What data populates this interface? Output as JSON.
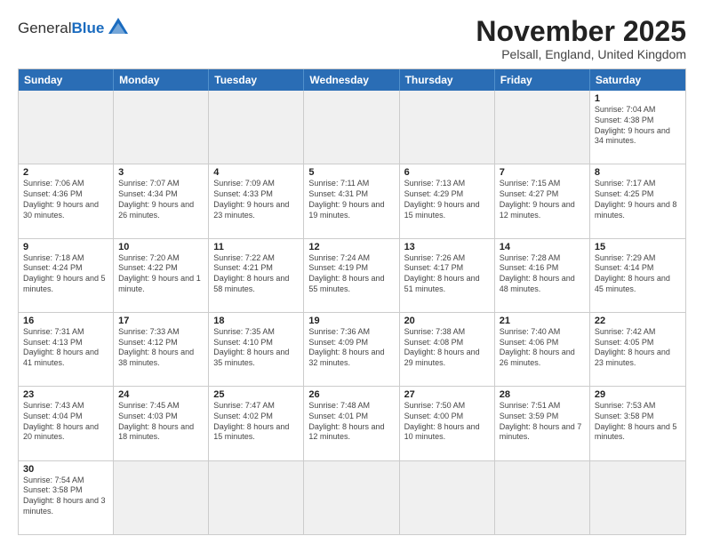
{
  "header": {
    "logo_line1": "General",
    "logo_line2": "Blue",
    "title": "November 2025",
    "subtitle": "Pelsall, England, United Kingdom"
  },
  "days_of_week": [
    "Sunday",
    "Monday",
    "Tuesday",
    "Wednesday",
    "Thursday",
    "Friday",
    "Saturday"
  ],
  "weeks": [
    [
      {
        "day": "",
        "empty": true
      },
      {
        "day": "",
        "empty": true
      },
      {
        "day": "",
        "empty": true
      },
      {
        "day": "",
        "empty": true
      },
      {
        "day": "",
        "empty": true
      },
      {
        "day": "",
        "empty": true
      },
      {
        "day": "1",
        "info": "Sunrise: 7:04 AM\nSunset: 4:38 PM\nDaylight: 9 hours\nand 34 minutes."
      }
    ],
    [
      {
        "day": "2",
        "info": "Sunrise: 7:06 AM\nSunset: 4:36 PM\nDaylight: 9 hours\nand 30 minutes."
      },
      {
        "day": "3",
        "info": "Sunrise: 7:07 AM\nSunset: 4:34 PM\nDaylight: 9 hours\nand 26 minutes."
      },
      {
        "day": "4",
        "info": "Sunrise: 7:09 AM\nSunset: 4:33 PM\nDaylight: 9 hours\nand 23 minutes."
      },
      {
        "day": "5",
        "info": "Sunrise: 7:11 AM\nSunset: 4:31 PM\nDaylight: 9 hours\nand 19 minutes."
      },
      {
        "day": "6",
        "info": "Sunrise: 7:13 AM\nSunset: 4:29 PM\nDaylight: 9 hours\nand 15 minutes."
      },
      {
        "day": "7",
        "info": "Sunrise: 7:15 AM\nSunset: 4:27 PM\nDaylight: 9 hours\nand 12 minutes."
      },
      {
        "day": "8",
        "info": "Sunrise: 7:17 AM\nSunset: 4:25 PM\nDaylight: 9 hours\nand 8 minutes."
      }
    ],
    [
      {
        "day": "9",
        "info": "Sunrise: 7:18 AM\nSunset: 4:24 PM\nDaylight: 9 hours\nand 5 minutes."
      },
      {
        "day": "10",
        "info": "Sunrise: 7:20 AM\nSunset: 4:22 PM\nDaylight: 9 hours\nand 1 minute."
      },
      {
        "day": "11",
        "info": "Sunrise: 7:22 AM\nSunset: 4:21 PM\nDaylight: 8 hours\nand 58 minutes."
      },
      {
        "day": "12",
        "info": "Sunrise: 7:24 AM\nSunset: 4:19 PM\nDaylight: 8 hours\nand 55 minutes."
      },
      {
        "day": "13",
        "info": "Sunrise: 7:26 AM\nSunset: 4:17 PM\nDaylight: 8 hours\nand 51 minutes."
      },
      {
        "day": "14",
        "info": "Sunrise: 7:28 AM\nSunset: 4:16 PM\nDaylight: 8 hours\nand 48 minutes."
      },
      {
        "day": "15",
        "info": "Sunrise: 7:29 AM\nSunset: 4:14 PM\nDaylight: 8 hours\nand 45 minutes."
      }
    ],
    [
      {
        "day": "16",
        "info": "Sunrise: 7:31 AM\nSunset: 4:13 PM\nDaylight: 8 hours\nand 41 minutes."
      },
      {
        "day": "17",
        "info": "Sunrise: 7:33 AM\nSunset: 4:12 PM\nDaylight: 8 hours\nand 38 minutes."
      },
      {
        "day": "18",
        "info": "Sunrise: 7:35 AM\nSunset: 4:10 PM\nDaylight: 8 hours\nand 35 minutes."
      },
      {
        "day": "19",
        "info": "Sunrise: 7:36 AM\nSunset: 4:09 PM\nDaylight: 8 hours\nand 32 minutes."
      },
      {
        "day": "20",
        "info": "Sunrise: 7:38 AM\nSunset: 4:08 PM\nDaylight: 8 hours\nand 29 minutes."
      },
      {
        "day": "21",
        "info": "Sunrise: 7:40 AM\nSunset: 4:06 PM\nDaylight: 8 hours\nand 26 minutes."
      },
      {
        "day": "22",
        "info": "Sunrise: 7:42 AM\nSunset: 4:05 PM\nDaylight: 8 hours\nand 23 minutes."
      }
    ],
    [
      {
        "day": "23",
        "info": "Sunrise: 7:43 AM\nSunset: 4:04 PM\nDaylight: 8 hours\nand 20 minutes."
      },
      {
        "day": "24",
        "info": "Sunrise: 7:45 AM\nSunset: 4:03 PM\nDaylight: 8 hours\nand 18 minutes."
      },
      {
        "day": "25",
        "info": "Sunrise: 7:47 AM\nSunset: 4:02 PM\nDaylight: 8 hours\nand 15 minutes."
      },
      {
        "day": "26",
        "info": "Sunrise: 7:48 AM\nSunset: 4:01 PM\nDaylight: 8 hours\nand 12 minutes."
      },
      {
        "day": "27",
        "info": "Sunrise: 7:50 AM\nSunset: 4:00 PM\nDaylight: 8 hours\nand 10 minutes."
      },
      {
        "day": "28",
        "info": "Sunrise: 7:51 AM\nSunset: 3:59 PM\nDaylight: 8 hours\nand 7 minutes."
      },
      {
        "day": "29",
        "info": "Sunrise: 7:53 AM\nSunset: 3:58 PM\nDaylight: 8 hours\nand 5 minutes."
      }
    ],
    [
      {
        "day": "30",
        "info": "Sunrise: 7:54 AM\nSunset: 3:58 PM\nDaylight: 8 hours\nand 3 minutes."
      },
      {
        "day": "",
        "empty": true
      },
      {
        "day": "",
        "empty": true
      },
      {
        "day": "",
        "empty": true
      },
      {
        "day": "",
        "empty": true
      },
      {
        "day": "",
        "empty": true
      },
      {
        "day": "",
        "empty": true
      }
    ]
  ]
}
